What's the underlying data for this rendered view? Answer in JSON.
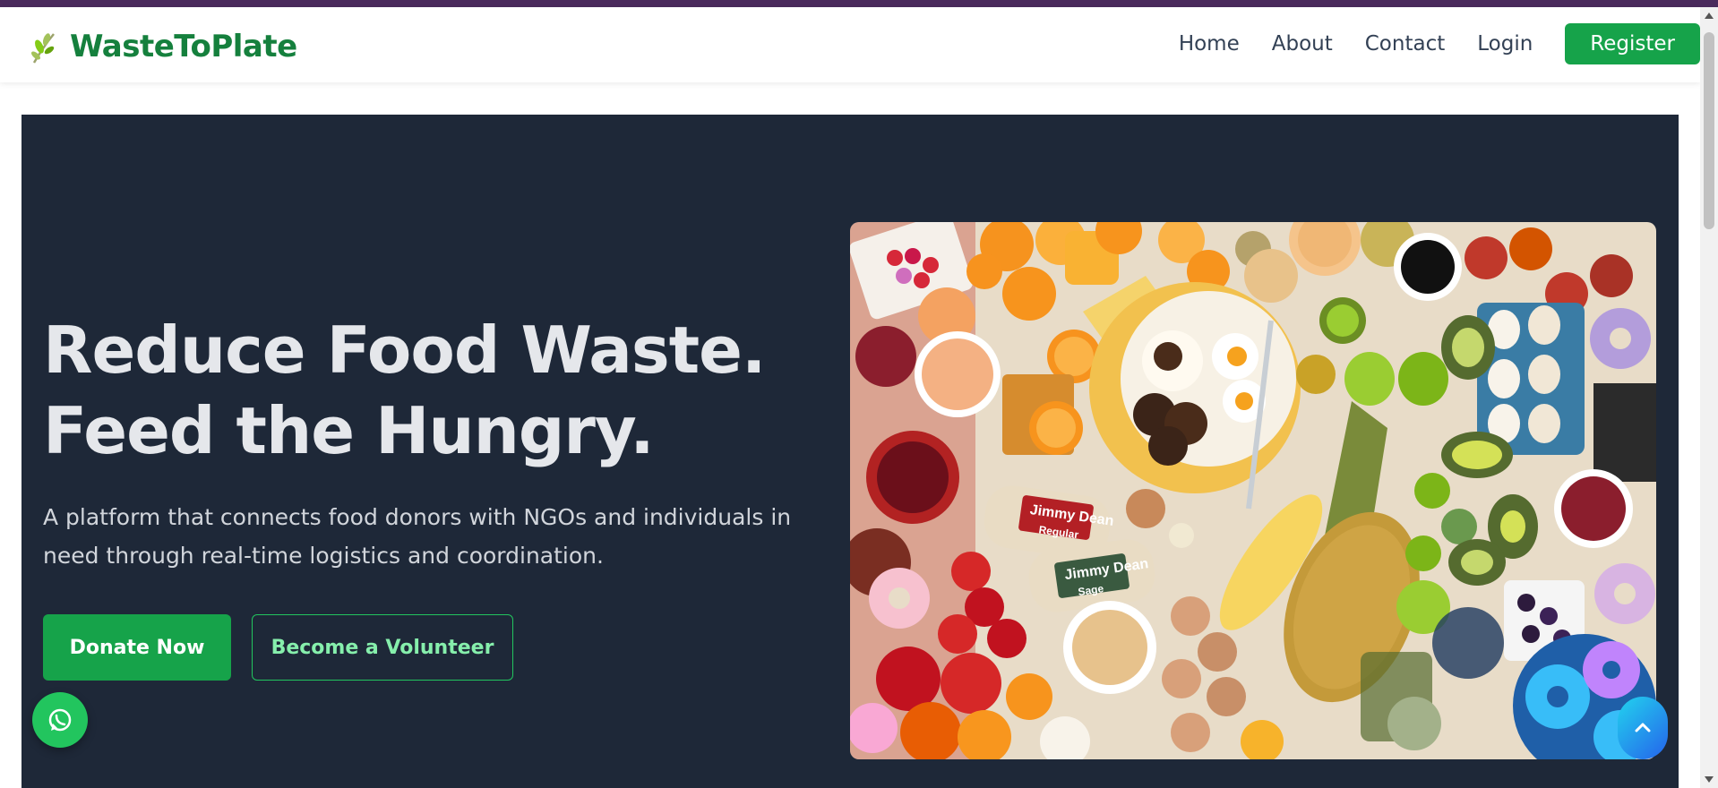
{
  "brand": {
    "name": "WasteToPlate",
    "logo_icon": "leaf-icon",
    "color": "#15803d"
  },
  "nav": {
    "links": [
      {
        "label": "Home"
      },
      {
        "label": "About"
      },
      {
        "label": "Contact"
      },
      {
        "label": "Login"
      }
    ],
    "register_label": "Register"
  },
  "hero": {
    "title_line1": "Reduce Food Waste.",
    "title_line2": "Feed the Hungry.",
    "description": "A platform that connects food donors with NGOs and individuals in need through real-time logistics and coordination.",
    "primary_button": "Donate Now",
    "secondary_button": "Become a Volunteer",
    "image_alt": "Assorted breakfast food spread"
  },
  "image_labels": {
    "package1_brand": "Jimmy Dean",
    "package1_variant": "Regular",
    "package2_brand": "Jimmy Dean",
    "package2_variant": "Sage"
  },
  "floating": {
    "whatsapp_icon": "whatsapp-icon",
    "to_top_icon": "chevron-up-icon"
  },
  "colors": {
    "accent": "#16a34a",
    "hero_bg": "#1e2838",
    "top_strip": "#4a2a5c"
  }
}
